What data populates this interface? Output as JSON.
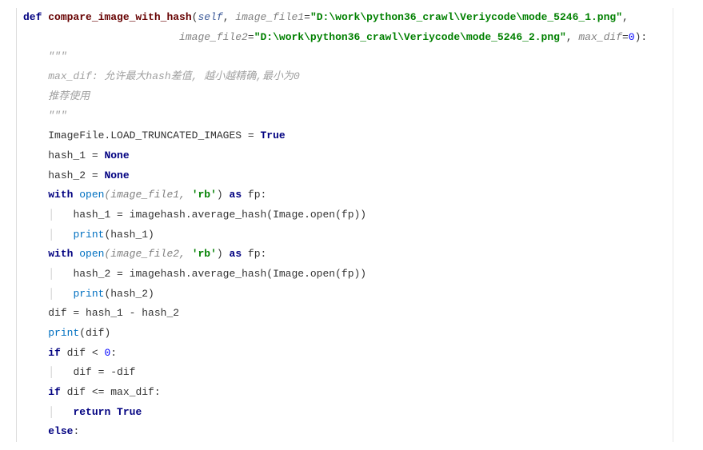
{
  "code": {
    "def_kw": "def",
    "fn_name": "compare_image_with_hash",
    "self": "self",
    "p1_name": "image_file1",
    "p1_val": "\"D:\\work\\python36_crawl\\Veriycode\\mode_5246_1.png\"",
    "p2_name": "image_file2",
    "p2_val": "\"D:\\work\\python36_crawl\\Veriycode\\mode_5246_2.png\"",
    "p3_name": "max_dif",
    "p3_val": "0",
    "doc_quotes_open": "\"\"\"",
    "doc_line1": "max_dif: 允许最大hash差值, 越小越精确,最小为0",
    "doc_line2": "推荐使用",
    "doc_quotes_close": "\"\"\"",
    "l_imgfile": "ImageFile.LOAD_TRUNCATED_IMAGES = ",
    "l_true": "True",
    "l_hash1": "hash_1 = ",
    "l_hash2": "hash_2 = ",
    "l_none": "None",
    "l_with": "with",
    "l_open": "open",
    "l_openarg1": "(image_file1, ",
    "l_rb": "'rb'",
    "l_closeparen_as": ") ",
    "l_as": "as",
    "l_fp": " fp:",
    "l_hash1_assign": "hash_1 = imagehash.average_hash(Image.open(fp))",
    "l_print": "print",
    "l_print_h1": "(hash_1)",
    "l_openarg2": "(image_file2, ",
    "l_hash2_assign": "hash_2 = imagehash.average_hash(Image.open(fp))",
    "l_print_h2": "(hash_2)",
    "l_dif": "dif = hash_1 - hash_2",
    "l_print_dif": "(dif)",
    "l_if": "if",
    "l_cond1": " dif < ",
    "l_zero": "0",
    "l_colon": ":",
    "l_dif_neg": "dif = -dif",
    "l_cond2": " dif <= max_dif:",
    "l_return": "return",
    "l_return_true": " True",
    "l_else": "else",
    "sp1": "    ",
    "sp2": "        ",
    "sp_cont": "                         "
  }
}
